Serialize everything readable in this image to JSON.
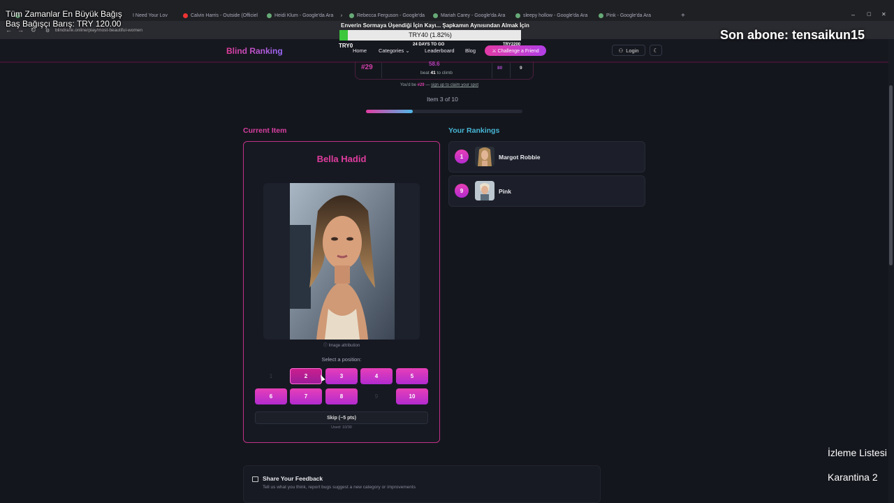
{
  "browser": {
    "tabs": [
      {
        "label": "Tüm Zamanlar En Büyük Bağış"
      },
      {
        "label": "I Need Your Lov"
      },
      {
        "label": "Calvin Harris - Outside (Officiel"
      },
      {
        "label": "Heidi Klum - Google'da Ara"
      },
      {
        "label": "Rebecca Ferguson - Google'da"
      },
      {
        "label": "Mariah Carey - Google'da Ara"
      },
      {
        "label": "sleepy hollow - Google'da Ara"
      },
      {
        "label": "Pink - Google'da Ara"
      }
    ],
    "new_tab": "+",
    "url": "blindrank.online/play/most-beautiful-women",
    "controls": {
      "minimize": "–",
      "maximize": "▢",
      "close": "✕"
    }
  },
  "overlay": {
    "top_alltime_line1": "Tüm Zamanlar En Büyük Bağış",
    "top_alltime_line2": "Baş Bağışçı Barış: TRY 120.00",
    "donation_title": "Enverin Sormaya Üşendiği İçin Kayı... Şapkamın Aynısından Almak İçin",
    "donation_amount": "TRY40 (1.82%)",
    "donation_progress": 0.0182,
    "donation_left": "TRY0",
    "donation_days": "24 DAYS TO GO",
    "donation_right": "TRY2200",
    "subscriber": "Son abone: tensaikun15",
    "watchlist": "İzleme Listesi",
    "quarantine": "Karantina 2"
  },
  "header": {
    "brand": "Blind Ranking",
    "nav": [
      "Home",
      "Categories",
      "Leaderboard",
      "Blog"
    ],
    "categories_chevron": "⌄",
    "challenge": "⚔ Challenge a Friend",
    "login": "Login",
    "login_icon": "user-icon",
    "theme_icon": "moon-icon",
    "theme_glyph": "☾"
  },
  "rank_banner": {
    "rank": "#29",
    "score": "58.6",
    "beat_prefix": "beat",
    "beat_value": "41",
    "beat_suffix": "to climb",
    "stat1": "80",
    "stat2": "9",
    "claim_prefix": "You'd be",
    "claim_rank": "#29",
    "claim_dash": "—",
    "claim_link": "sign up to claim your spot"
  },
  "progress": {
    "label": "Item 3 of 10",
    "current": 3,
    "total": 10
  },
  "current_item": {
    "section_title": "Current Item",
    "name": "Bella Hadid",
    "attribution": "ⓘ Image attribution",
    "select_label": "Select a position:",
    "positions": [
      {
        "label": "1",
        "available": false
      },
      {
        "label": "2",
        "available": true
      },
      {
        "label": "3",
        "available": true
      },
      {
        "label": "4",
        "available": true
      },
      {
        "label": "5",
        "available": true
      },
      {
        "label": "6",
        "available": true
      },
      {
        "label": "7",
        "available": true
      },
      {
        "label": "8",
        "available": true
      },
      {
        "label": "9",
        "available": false
      },
      {
        "label": "10",
        "available": true
      }
    ],
    "skip": "Skip (−5 pts)",
    "used": "Used: 10/30"
  },
  "rankings": {
    "section_title": "Your Rankings",
    "items": [
      {
        "rank": "1",
        "name": "Margot Robbie"
      },
      {
        "rank": "9",
        "name": "Pink"
      }
    ]
  },
  "feedback": {
    "title": "Share Your Feedback",
    "subtitle": "Tell us what you think, report bugs suggest a new category or improvements",
    "icon": "chat-icon"
  },
  "colors": {
    "accent_pink": "#e03c9e",
    "accent_purple": "#b22bcf",
    "accent_cyan": "#46b7d6",
    "background": "#14161d"
  }
}
